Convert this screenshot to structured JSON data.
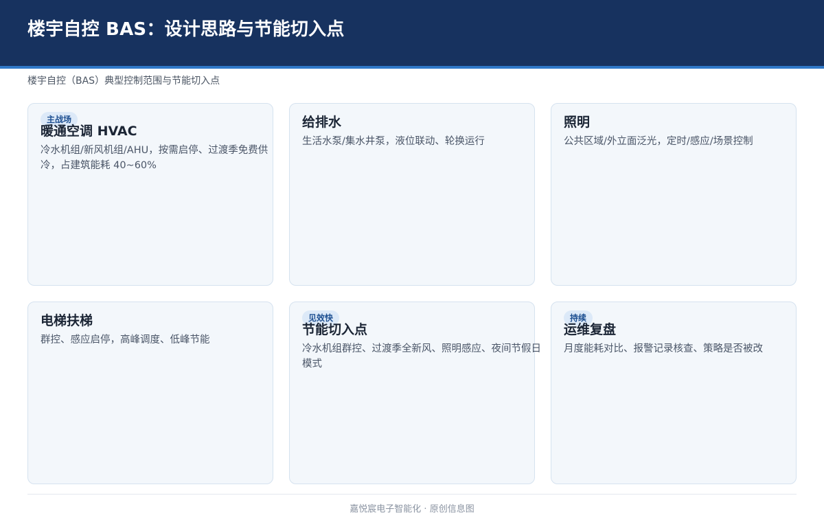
{
  "header": {
    "title": "楼宇自控 BAS：设计思路与节能切入点"
  },
  "subtitle": "楼宇自控（BAS）典型控制范围与节能切入点",
  "cards": [
    {
      "badge": "主战场",
      "title": "暖通空调 HVAC",
      "desc": "冷水机组/新风机组/AHU，按需启停、过渡季免费供冷，占建筑能耗 40~60%"
    },
    {
      "title": "给排水",
      "desc": "生活水泵/集水井泵，液位联动、轮换运行"
    },
    {
      "title": "照明",
      "desc": "公共区域/外立面泛光，定时/感应/场景控制"
    },
    {
      "title": "电梯扶梯",
      "desc": "群控、感应启停，高峰调度、低峰节能"
    },
    {
      "badge": "见效快",
      "title": "节能切入点",
      "desc": "冷水机组群控、过渡季全新风、照明感应、夜间节假日模式"
    },
    {
      "badge": "持续",
      "title": "运维复盘",
      "desc": "月度能耗对比、报警记录核查、策略是否被改"
    }
  ],
  "footer": {
    "text": "嘉悦宸电子智能化 · 原创信息图"
  }
}
